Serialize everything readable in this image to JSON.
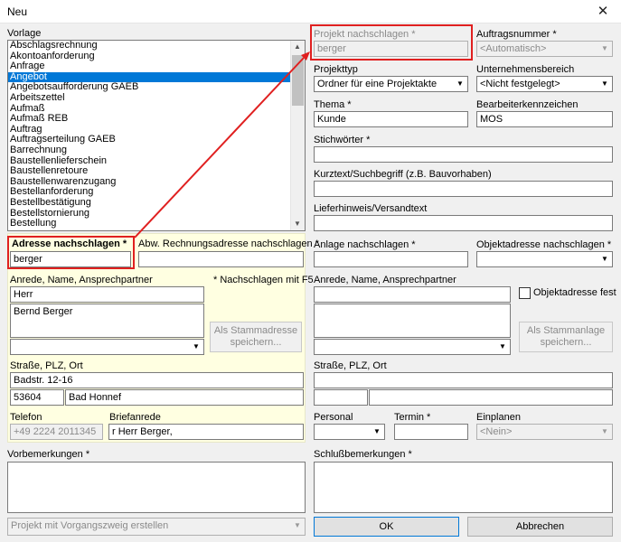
{
  "window": {
    "title": "Neu",
    "close_symbol": "✕"
  },
  "vorlage": {
    "label": "Vorlage",
    "items": [
      "Abschlagsrechnung",
      "Akontoanforderung",
      "Anfrage",
      "Angebot",
      "Angebotsaufforderung GAEB",
      "Arbeitszettel",
      "Aufmaß",
      "Aufmaß REB",
      "Auftrag",
      "Auftragserteilung GAEB",
      "Barrechnung",
      "Baustellenlieferschein",
      "Baustellenretoure",
      "Baustellenwarenzugang",
      "Bestellanforderung",
      "Bestellbestätigung",
      "Bestellstornierung",
      "Bestellung"
    ],
    "selected": "Angebot"
  },
  "adresse": {
    "label": "Adresse nachschlagen *",
    "value": "berger",
    "abw_label": "Abw. Rechnungsadresse nachschlagen *",
    "abw_value": "",
    "anrede_label": "Anrede, Name, Ansprechpartner",
    "hint": "* Nachschlagen mit F5",
    "anrede": "Herr",
    "name": "Bernd Berger",
    "ansprechpartner": "",
    "stamm_button": "Als Stammadresse speichern...",
    "strasse_label": "Straße, PLZ, Ort",
    "strasse": "Badstr. 12-16",
    "plz": "53604",
    "ort": "Bad Honnef",
    "telefon_label": "Telefon",
    "telefon": "+49 2224 2011345",
    "briefanrede_label": "Briefanrede",
    "briefanrede": "r Herr Berger,"
  },
  "vorbemerkungen": {
    "label": "Vorbemerkungen *",
    "value": ""
  },
  "vorgang": {
    "value": "Projekt mit Vorgangszweig erstellen"
  },
  "projekt": {
    "nachschlagen_label": "Projekt nachschlagen *",
    "nachschlagen_value": "berger",
    "auftragsnummer_label": "Auftragsnummer *",
    "auftragsnummer_value": "<Automatisch>",
    "projekttyp_label": "Projekttyp",
    "projekttyp_value": "Ordner für eine Projektakte",
    "unternehmensbereich_label": "Unternehmensbereich",
    "unternehmensbereich_value": "<Nicht festgelegt>",
    "thema_label": "Thema *",
    "thema_value": "Kunde",
    "bearbeiter_label": "Bearbeiterkennzeichen",
    "bearbeiter_value": "MOS",
    "stichwoerter_label": "Stichwörter *",
    "kurztext_label": "Kurztext/Suchbegriff (z.B. Bauvorhaben)",
    "lieferhinweis_label": "Lieferhinweis/Versandtext"
  },
  "anlage": {
    "label": "Anlage nachschlagen *",
    "objektadresse_label": "Objektadresse nachschlagen *",
    "anrede_label": "Anrede, Name, Ansprechpartner",
    "objekt_fest_label": "Objektadresse fest",
    "stamm_button": "Als Stammanlage speichern...",
    "strasse_label": "Straße, PLZ, Ort",
    "personal_label": "Personal",
    "termin_label": "Termin *",
    "einplanen_label": "Einplanen",
    "einplanen_value": "<Nein>"
  },
  "schluss": {
    "label": "Schlußbemerkungen *"
  },
  "buttons": {
    "ok": "OK",
    "cancel": "Abbrechen"
  },
  "colors": {
    "highlight": "#0078d7",
    "annotation_red": "#e02020",
    "yellow_panel": "#ffffe1"
  }
}
